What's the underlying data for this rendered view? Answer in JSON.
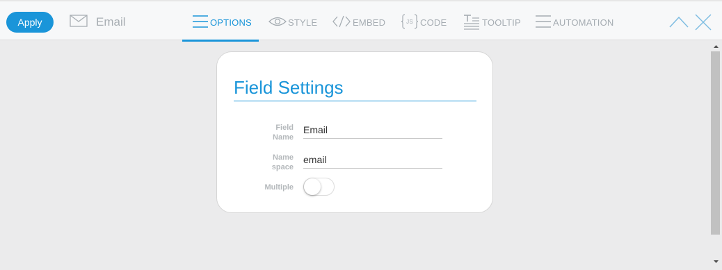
{
  "toolbar": {
    "apply_label": "Apply",
    "field_type_label": "Email",
    "field_type_icon": "envelope-icon",
    "collapse_icon": "chevron-up-icon",
    "close_icon": "close-icon"
  },
  "tabs": [
    {
      "label": "OPTIONS",
      "icon": "lines-icon",
      "active": true
    },
    {
      "label": "STYLE",
      "icon": "eye-icon",
      "active": false
    },
    {
      "label": "EMBED",
      "icon": "code-brackets-icon",
      "active": false
    },
    {
      "label": "CODE",
      "icon": "js-braces-icon",
      "active": false
    },
    {
      "label": "TOOLTIP",
      "icon": "text-tooltip-icon",
      "active": false
    },
    {
      "label": "AUTOMATION",
      "icon": "lines-icon",
      "active": false
    }
  ],
  "card": {
    "title": "Field Settings",
    "fields": {
      "field_name": {
        "label_line1": "Field",
        "label_line2": "Name",
        "value": "Email"
      },
      "name_space": {
        "label_line1": "Name",
        "label_line2": "space",
        "value": "email"
      },
      "multiple": {
        "label": "Multiple",
        "on": false
      }
    }
  },
  "colors": {
    "accent": "#1a95d9",
    "muted": "#a5acb2",
    "background": "#ebebec"
  }
}
